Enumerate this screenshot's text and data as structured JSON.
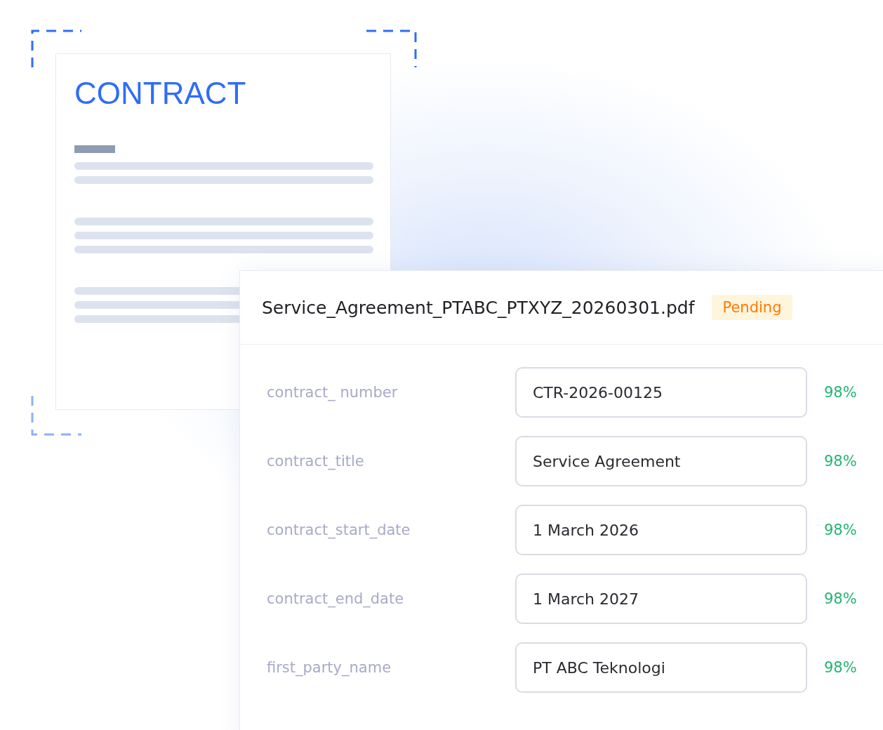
{
  "document": {
    "title": "CONTRACT"
  },
  "card": {
    "filename": "Service_Agreement_PTABC_PTXYZ_20260301.pdf",
    "status": "Pending",
    "fields": [
      {
        "label": "contract_ number",
        "value": "CTR-2026-00125",
        "confidence": "98%"
      },
      {
        "label": "contract_title",
        "value": "Service Agreement",
        "confidence": "98%"
      },
      {
        "label": "contract_start_date",
        "value": "1 March 2026",
        "confidence": "98%"
      },
      {
        "label": "contract_end_date",
        "value": "1 March 2027",
        "confidence": "98%"
      },
      {
        "label": "first_party_name",
        "value": "PT ABC Teknologi",
        "confidence": "98%"
      }
    ]
  }
}
